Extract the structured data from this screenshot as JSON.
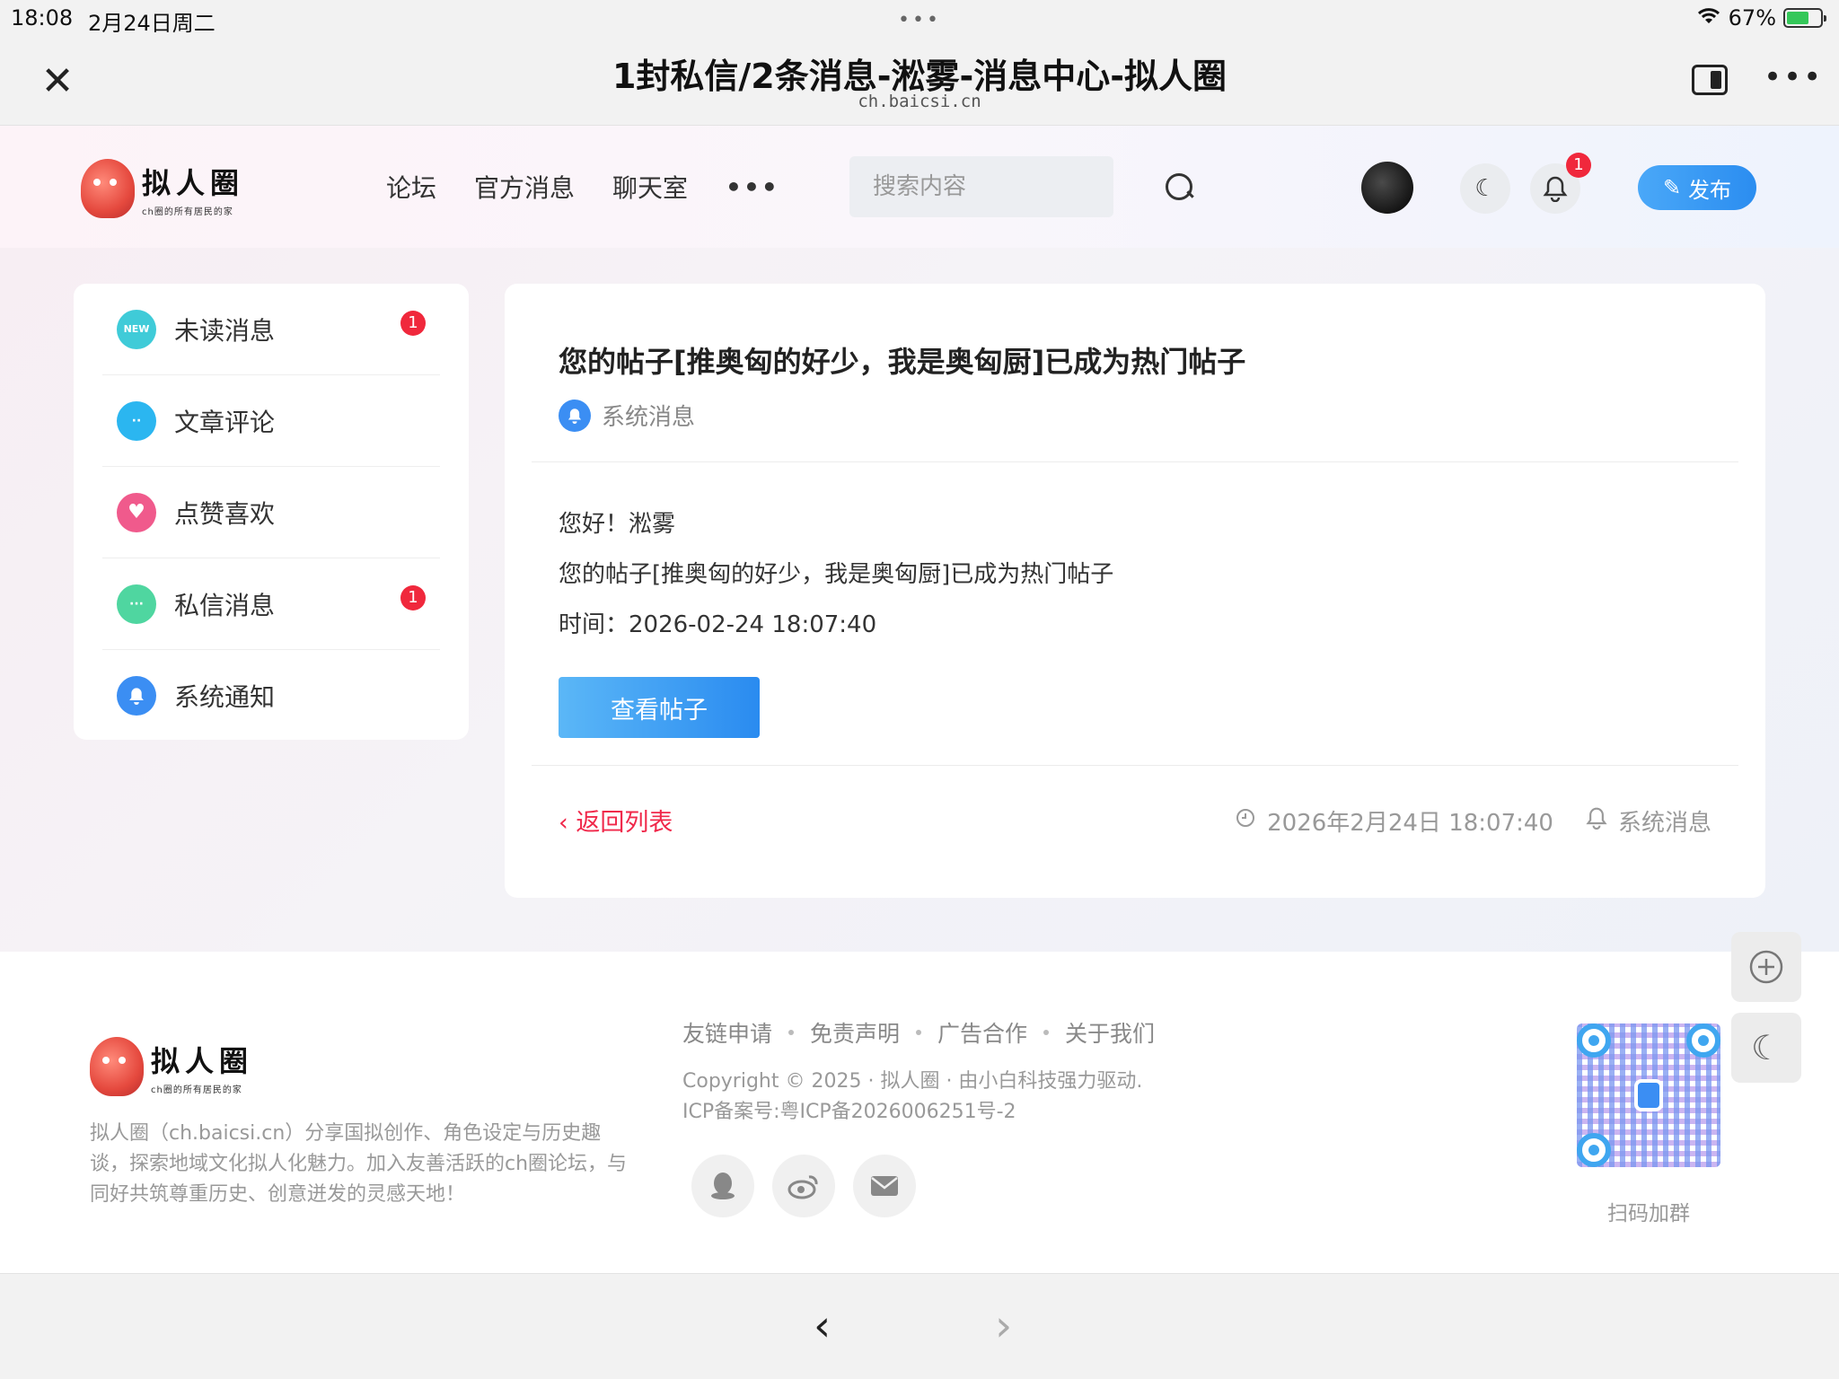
{
  "status_bar": {
    "time": "18:08",
    "date": "2月24日周二",
    "battery": "67%",
    "battery_level": 0.67
  },
  "browser": {
    "title": "1封私信/2条消息-淞雾-消息中心-拟人圈",
    "url": "ch.baicsi.cn"
  },
  "header": {
    "logo_text": "拟人圈",
    "logo_subtitle": "ch圈的所有居民的家",
    "nav": [
      "论坛",
      "官方消息",
      "聊天室"
    ],
    "search_placeholder": "搜索内容",
    "bell_badge": "1",
    "publish_label": "发布"
  },
  "sidebar": {
    "items": [
      {
        "label": "未读消息",
        "badge": "1",
        "icon": "new-icon",
        "color": "#3fcbd8",
        "icon_text": "NEW"
      },
      {
        "label": "文章评论",
        "badge": "",
        "icon": "comment-icon",
        "color": "#2bb6f0",
        "icon_text": "··"
      },
      {
        "label": "点赞喜欢",
        "badge": "",
        "icon": "heart-icon",
        "color": "#f05a8c",
        "icon_text": "♥"
      },
      {
        "label": "私信消息",
        "badge": "1",
        "icon": "chat-icon",
        "color": "#4fd6a0",
        "icon_text": "···"
      },
      {
        "label": "系统通知",
        "badge": "",
        "icon": "bell-icon",
        "color": "#3b8ef3",
        "icon_text": "🔔"
      }
    ]
  },
  "message": {
    "title": "您的帖子[推奥匈的好少，我是奥匈厨]已成为热门帖子",
    "type_label": "系统消息",
    "greeting": "您好！淞雾",
    "body": "您的帖子[推奥匈的好少，我是奥匈厨]已成为热门帖子",
    "time_line": "时间：2026-02-24 18:07:40",
    "view_button": "查看帖子",
    "back_link": "返回列表",
    "meta_time": "2026年2月24日 18:07:40",
    "meta_type": "系统消息"
  },
  "footer": {
    "logo_text": "拟人圈",
    "logo_subtitle": "ch圈的所有居民的家",
    "description": "拟人圈（ch.baicsi.cn）分享国拟创作、角色设定与历史趣谈，探索地域文化拟人化魅力。加入友善活跃的ch圈论坛，与同好共筑尊重历史、创意迸发的灵感天地！",
    "links": [
      "友链申请",
      "免责声明",
      "广告合作",
      "关于我们"
    ],
    "copyright": "Copyright © 2025 · 拟人圈 · 由小白科技强力驱动.",
    "icp": "ICP备案号:粤ICP备2026006251号-2",
    "qr_label": "扫码加群"
  }
}
